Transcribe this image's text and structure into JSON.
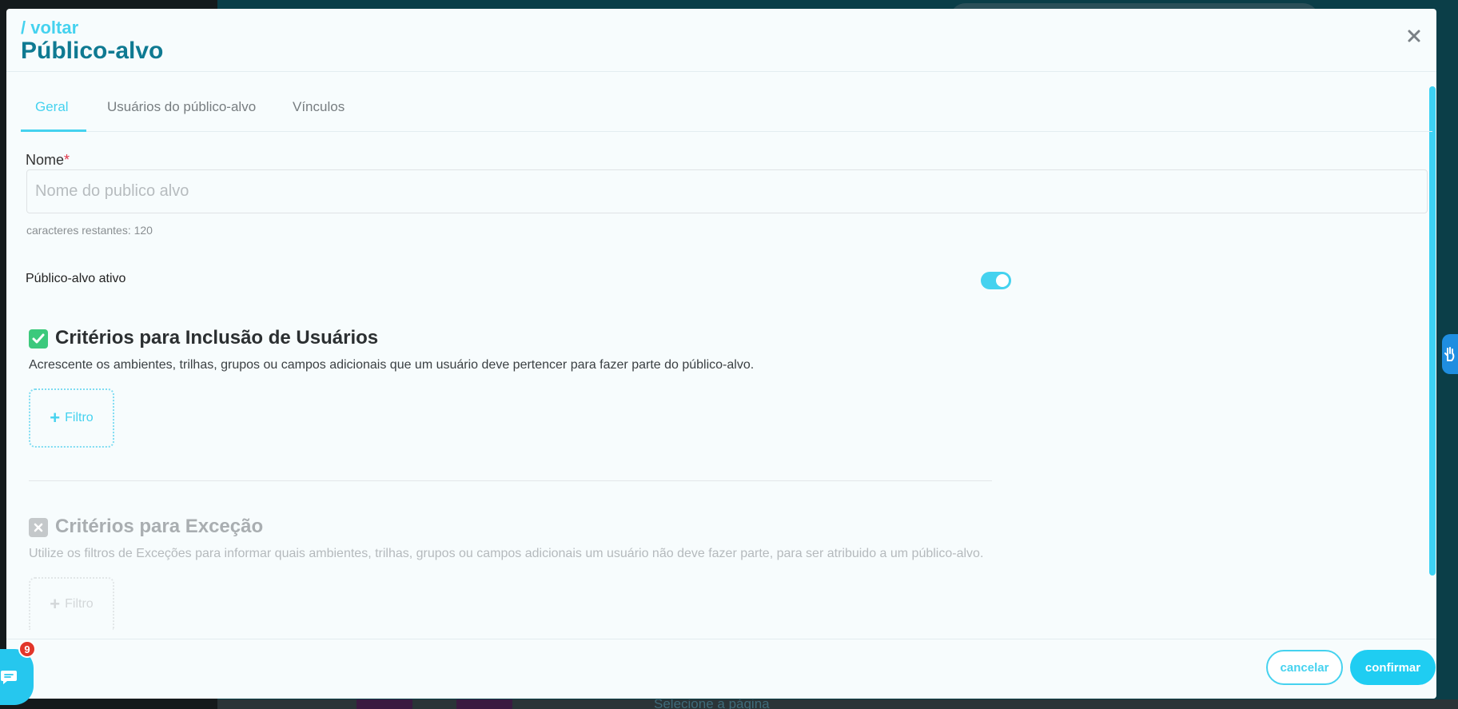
{
  "header": {
    "back_label": "/ voltar",
    "title": "Público-alvo",
    "close_icon": "close-icon"
  },
  "tabs": [
    {
      "label": "Geral",
      "active": true
    },
    {
      "label": "Usuários do público-alvo",
      "active": false
    },
    {
      "label": "Vínculos",
      "active": false
    }
  ],
  "form": {
    "name_label": "Nome",
    "required_mark": "*",
    "name_placeholder": "Nome do publico alvo",
    "name_value": "",
    "remaining_chars": "caracteres restantes: 120",
    "active_label": "Público-alvo ativo",
    "active": true
  },
  "inclusion": {
    "enabled": true,
    "title": "Critérios para Inclusão de Usuários",
    "description": "Acrescente os ambientes, trilhas, grupos ou campos adicionais que um usuário deve pertencer para fazer parte do público-alvo.",
    "filter_label": "Filtro"
  },
  "exception": {
    "enabled": false,
    "title": "Critérios para Exceção",
    "description": "Utilize os filtros de Exceções para informar quais ambientes, trilhas, grupos ou campos adicionais um usuário não deve fazer parte, para ser atribuido a um público-alvo.",
    "filter_label": "Filtro"
  },
  "footer": {
    "cancel_label": "cancelar",
    "confirm_label": "confirmar"
  },
  "chat_widget": {
    "badge_count": "9",
    "icon": "chat-icon"
  },
  "accessibility_widget": {
    "icon": "hand-sign-icon"
  },
  "background": {
    "partial_text": "Selecione a página"
  },
  "colors": {
    "accent": "#45d2ef",
    "title": "#0f7a92",
    "success": "#3cc97c",
    "disabled": "#c4c8ca",
    "required": "#e0364a",
    "badge": "#e2362a"
  }
}
